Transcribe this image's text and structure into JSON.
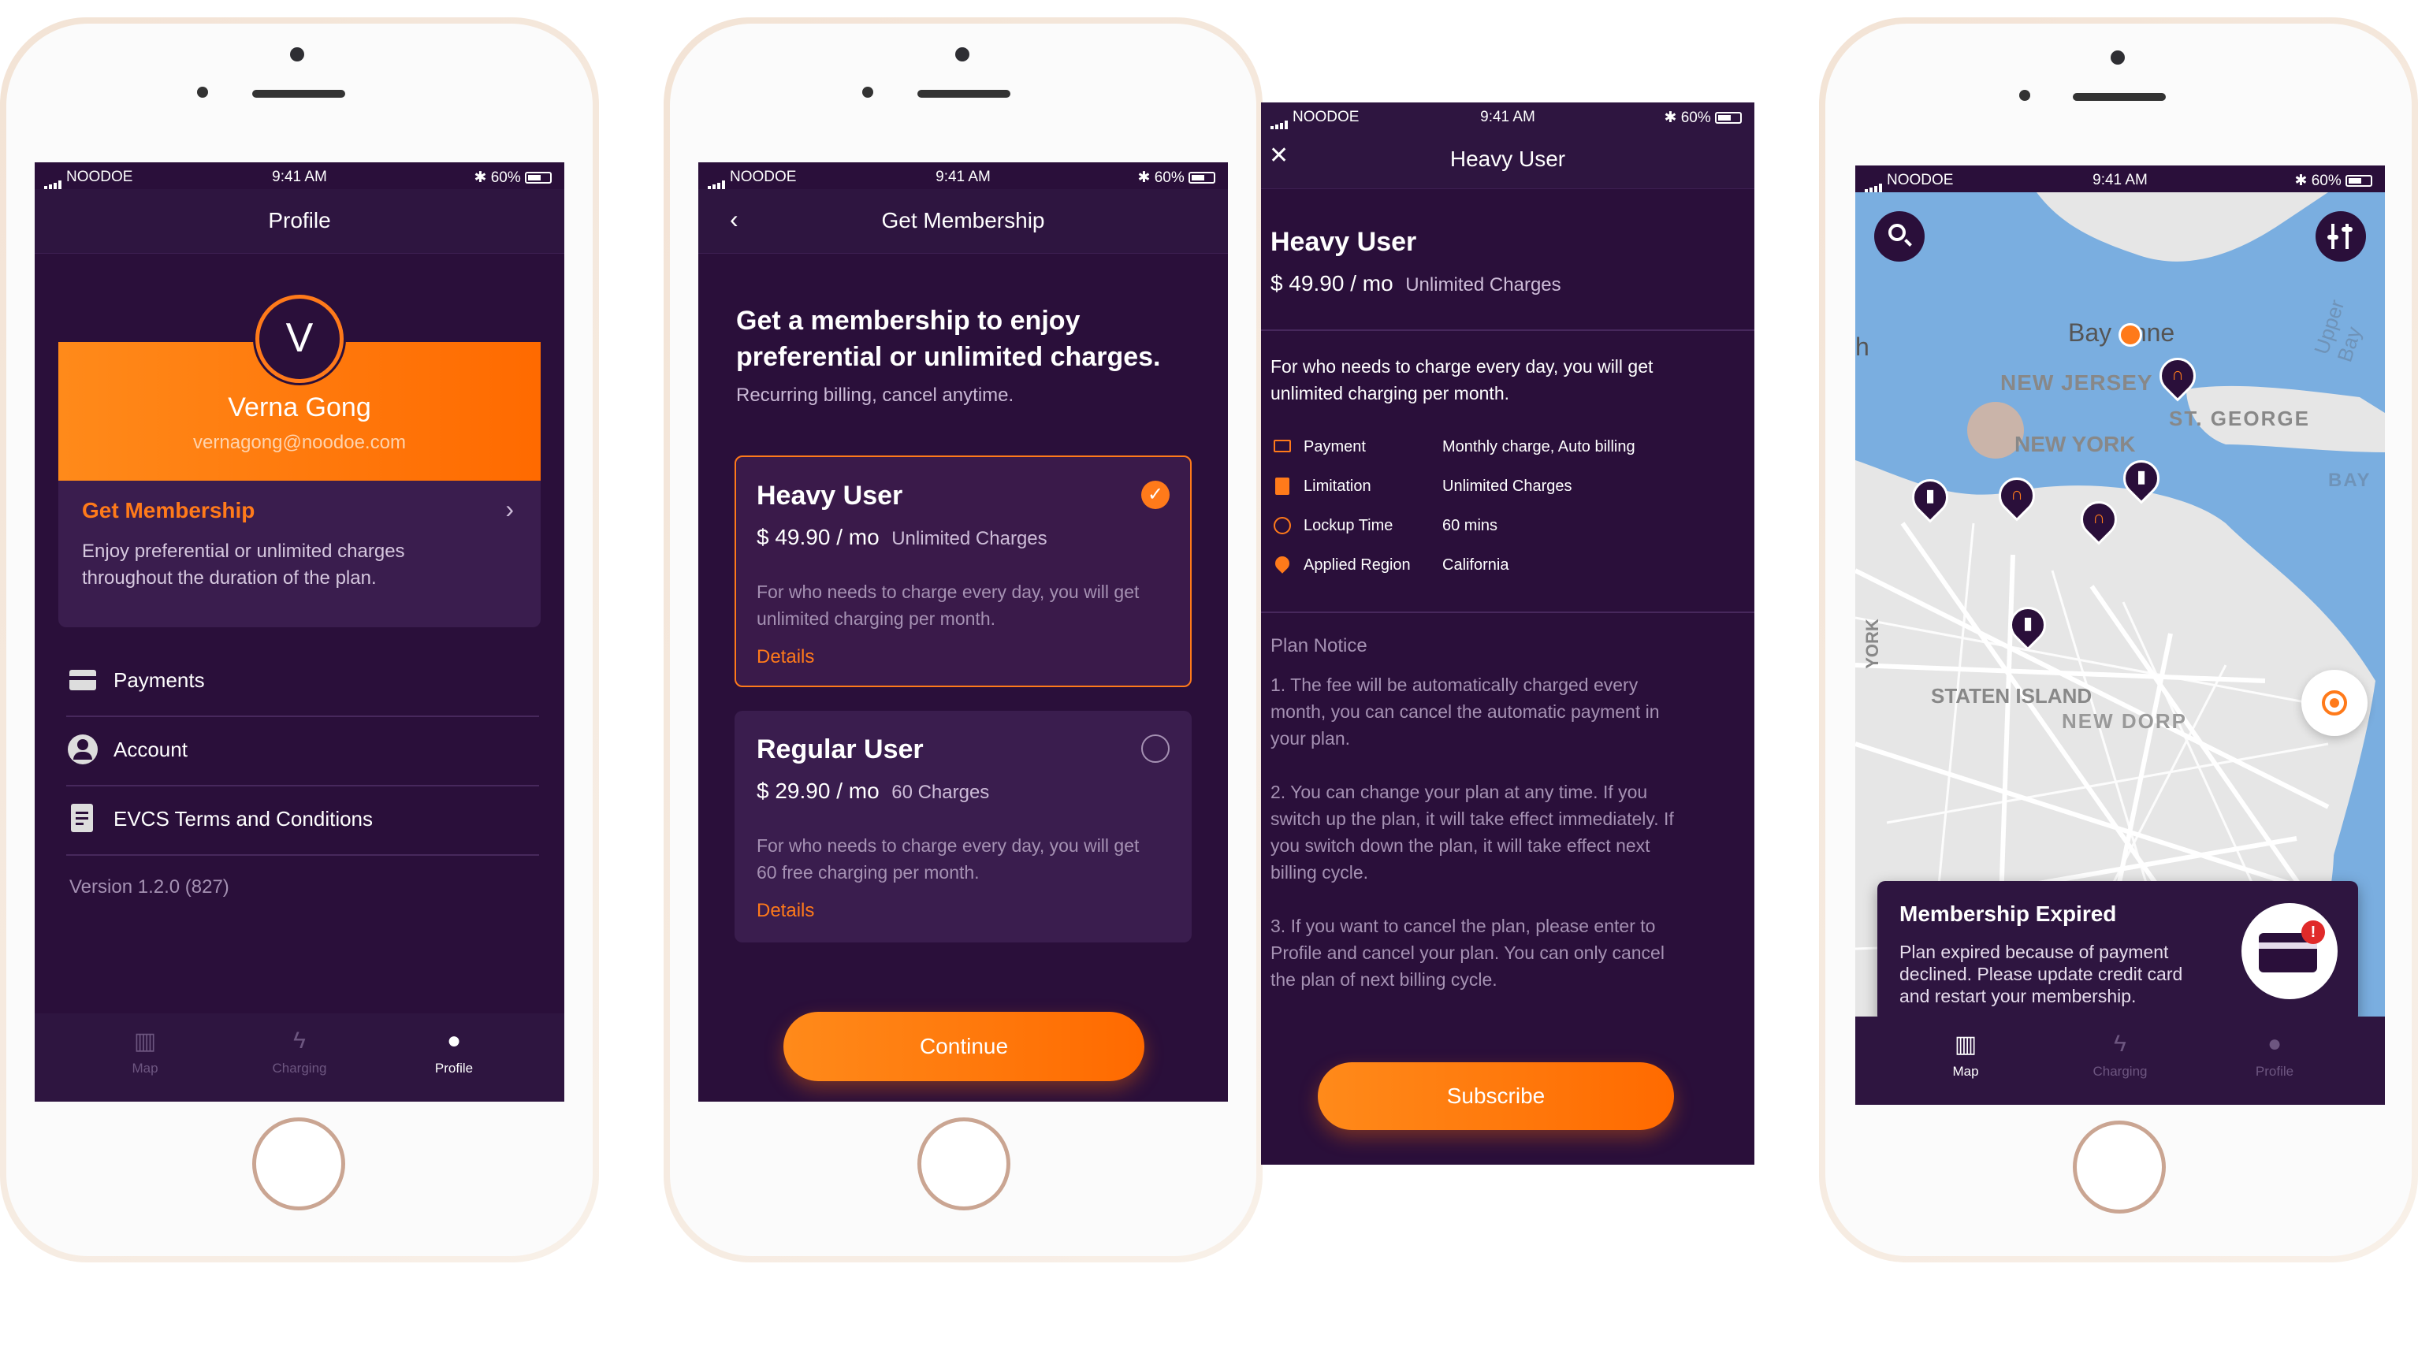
{
  "status": {
    "carrier": "NOODOE",
    "time": "9:41 AM",
    "battery": "60%"
  },
  "profile": {
    "title": "Profile",
    "avatar_letter": "V",
    "name": "Verna Gong",
    "email": "vernagong@noodoe.com",
    "membership_title": "Get Membership",
    "membership_desc_1": "Enjoy preferential or unlimited charges",
    "membership_desc_2": "throughout the duration of the plan.",
    "menu": [
      {
        "label": "Payments",
        "icon": "card-icon"
      },
      {
        "label": "Account",
        "icon": "user-circle-icon"
      },
      {
        "label": "EVCS Terms and Conditions",
        "icon": "document-icon"
      }
    ],
    "version": "Version 1.2.0 (827)"
  },
  "tabs": [
    {
      "label": "Map",
      "icon": "map-icon"
    },
    {
      "label": "Charging",
      "icon": "bolt-icon"
    },
    {
      "label": "Profile",
      "icon": "person-icon"
    }
  ],
  "get_membership": {
    "title": "Get Membership",
    "headline_1": "Get a membership to enjoy",
    "headline_2": "preferential or unlimited charges.",
    "subline": "Recurring billing, cancel anytime.",
    "plans": [
      {
        "name": "Heavy User",
        "price": "$ 49.90 / mo",
        "charges": "Unlimited Charges",
        "desc_1": "For who needs to charge every day, you will get",
        "desc_2": "unlimited charging per month.",
        "link": "Details",
        "selected": true
      },
      {
        "name": "Regular User",
        "price": "$ 29.90 / mo",
        "charges": "60 Charges",
        "desc_1": "For who needs to charge every day, you will get",
        "desc_2": "60 free charging per month.",
        "link": "Details",
        "selected": false
      }
    ],
    "continue_label": "Continue"
  },
  "detail": {
    "title": "Heavy User",
    "plan_name": "Heavy User",
    "price": "$ 49.90 / mo",
    "charges": "Unlimited Charges",
    "desc_1": "For who needs to charge every day, you will get",
    "desc_2": "unlimited charging per month.",
    "rows": [
      {
        "label": "Payment",
        "value": "Monthly charge, Auto billing",
        "icon": "card-icon"
      },
      {
        "label": "Limitation",
        "value": "Unlimited Charges",
        "icon": "document-icon"
      },
      {
        "label": "Lockup Time",
        "value": "60 mins",
        "icon": "clock-icon"
      },
      {
        "label": "Applied Region",
        "value": "California",
        "icon": "location-pin-icon"
      }
    ],
    "notice_title": "Plan Notice",
    "notice_1": [
      "1. The fee will be automatically charged every",
      "month, you can cancel the automatic payment in",
      "your plan."
    ],
    "notice_2": [
      "2. You can change your plan at any time. If you",
      "switch up the plan, it will take effect immediately. If",
      "you switch down the plan, it will take effect next",
      "billing cycle."
    ],
    "notice_3": [
      "3. If you want to cancel the plan, please enter to",
      "Profile and cancel your plan. You can only cancel",
      "the plan of next billing cycle."
    ],
    "subscribe_label": "Subscribe"
  },
  "map": {
    "labels": {
      "bayonne_1": "Bay",
      "bayonne_2": "nne",
      "nj": "NEW JERSEY",
      "st_george": "ST. GEORGE",
      "ny": "NEW YORK",
      "staten": "STATEN ISLAND",
      "new_dorp": "NEW DORP",
      "upper_bay": "Upper Bay",
      "bay": "BAY",
      "york": "YORK",
      "h": "h"
    },
    "alert_title": "Membership Expired",
    "alert_lines": [
      "Plan expired because of payment",
      "declined. Please update credit card",
      "and restart your membership."
    ]
  },
  "colors": {
    "bg": "#2a0f3a",
    "accent": "#ff7a1a",
    "bar": "#2e1540"
  }
}
